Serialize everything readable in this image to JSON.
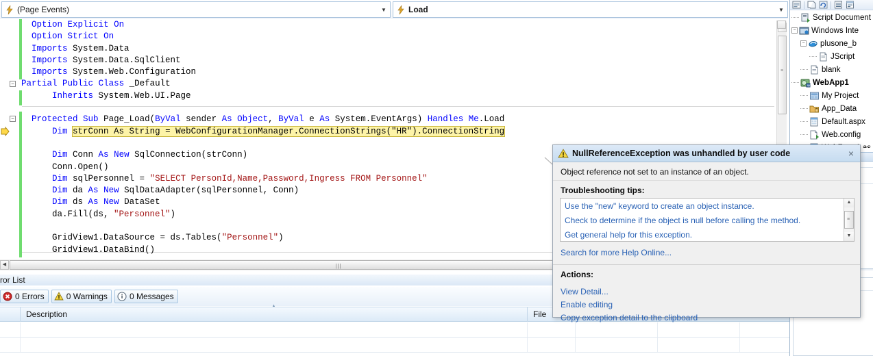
{
  "editor": {
    "member_combo": {
      "icon": "lightning-icon",
      "value": "(Page Events)"
    },
    "event_combo": {
      "icon": "lightning-icon",
      "value": "Load"
    },
    "code_lines": [
      [
        {
          "t": "    ",
          "c": "t"
        },
        {
          "t": "Option",
          "c": "k"
        },
        {
          "t": " ",
          "c": "t"
        },
        {
          "t": "Explicit",
          "c": "k"
        },
        {
          "t": " ",
          "c": "t"
        },
        {
          "t": "On",
          "c": "k"
        }
      ],
      [
        {
          "t": "    ",
          "c": "t"
        },
        {
          "t": "Option",
          "c": "k"
        },
        {
          "t": " ",
          "c": "t"
        },
        {
          "t": "Strict",
          "c": "k"
        },
        {
          "t": " ",
          "c": "t"
        },
        {
          "t": "On",
          "c": "k"
        }
      ],
      [
        {
          "t": "    ",
          "c": "t"
        },
        {
          "t": "Imports",
          "c": "k"
        },
        {
          "t": " System.Data",
          "c": "t"
        }
      ],
      [
        {
          "t": "    ",
          "c": "t"
        },
        {
          "t": "Imports",
          "c": "k"
        },
        {
          "t": " System.Data.SqlClient",
          "c": "t"
        }
      ],
      [
        {
          "t": "    ",
          "c": "t"
        },
        {
          "t": "Imports",
          "c": "k"
        },
        {
          "t": " System.Web.Configuration",
          "c": "t"
        }
      ],
      [
        {
          "t": "  ",
          "c": "t"
        },
        {
          "t": "Partial",
          "c": "k"
        },
        {
          "t": " ",
          "c": "t"
        },
        {
          "t": "Public",
          "c": "k"
        },
        {
          "t": " ",
          "c": "t"
        },
        {
          "t": "Class",
          "c": "k"
        },
        {
          "t": " _Default",
          "c": "t"
        }
      ],
      [
        {
          "t": "        ",
          "c": "t"
        },
        {
          "t": "Inherits",
          "c": "k"
        },
        {
          "t": " System.Web.UI.Page",
          "c": "t"
        }
      ],
      [
        {
          "t": "",
          "c": "t"
        }
      ],
      [
        {
          "t": "    ",
          "c": "t"
        },
        {
          "t": "Protected",
          "c": "k"
        },
        {
          "t": " ",
          "c": "t"
        },
        {
          "t": "Sub",
          "c": "k"
        },
        {
          "t": " Page_Load(",
          "c": "t"
        },
        {
          "t": "ByVal",
          "c": "k"
        },
        {
          "t": " sender ",
          "c": "t"
        },
        {
          "t": "As",
          "c": "k"
        },
        {
          "t": " ",
          "c": "t"
        },
        {
          "t": "Object",
          "c": "k"
        },
        {
          "t": ", ",
          "c": "t"
        },
        {
          "t": "ByVal",
          "c": "k"
        },
        {
          "t": " e ",
          "c": "t"
        },
        {
          "t": "As",
          "c": "k"
        },
        {
          "t": " System.EventArgs) ",
          "c": "t"
        },
        {
          "t": "Handles",
          "c": "k"
        },
        {
          "t": " ",
          "c": "t"
        },
        {
          "t": "Me",
          "c": "k"
        },
        {
          "t": ".Load",
          "c": "t"
        }
      ],
      [
        {
          "t": "        ",
          "c": "t"
        },
        {
          "t": "Dim",
          "c": "k"
        },
        {
          "t": " ",
          "c": "t"
        },
        {
          "t": "strConn As String = WebConfigurationManager.ConnectionStrings(\"HR\").ConnectionString",
          "c": "hl"
        }
      ],
      [
        {
          "t": "",
          "c": "t"
        }
      ],
      [
        {
          "t": "        ",
          "c": "t"
        },
        {
          "t": "Dim",
          "c": "k"
        },
        {
          "t": " Conn ",
          "c": "t"
        },
        {
          "t": "As",
          "c": "k"
        },
        {
          "t": " ",
          "c": "t"
        },
        {
          "t": "New",
          "c": "k"
        },
        {
          "t": " SqlConnection(strConn)",
          "c": "t"
        }
      ],
      [
        {
          "t": "        Conn.Open()",
          "c": "t"
        }
      ],
      [
        {
          "t": "        ",
          "c": "t"
        },
        {
          "t": "Dim",
          "c": "k"
        },
        {
          "t": " sqlPersonnel = ",
          "c": "t"
        },
        {
          "t": "\"SELECT PersonId,Name,Password,Ingress FROM Personnel\"",
          "c": "s"
        }
      ],
      [
        {
          "t": "        ",
          "c": "t"
        },
        {
          "t": "Dim",
          "c": "k"
        },
        {
          "t": " da ",
          "c": "t"
        },
        {
          "t": "As",
          "c": "k"
        },
        {
          "t": " ",
          "c": "t"
        },
        {
          "t": "New",
          "c": "k"
        },
        {
          "t": " SqlDataAdapter(sqlPersonnel, Conn)",
          "c": "t"
        }
      ],
      [
        {
          "t": "        ",
          "c": "t"
        },
        {
          "t": "Dim",
          "c": "k"
        },
        {
          "t": " ds ",
          "c": "t"
        },
        {
          "t": "As",
          "c": "k"
        },
        {
          "t": " ",
          "c": "t"
        },
        {
          "t": "New",
          "c": "k"
        },
        {
          "t": " DataSet",
          "c": "t"
        }
      ],
      [
        {
          "t": "        da.Fill(ds, ",
          "c": "t"
        },
        {
          "t": "\"Personnel\"",
          "c": "s"
        },
        {
          "t": ")",
          "c": "t"
        }
      ],
      [
        {
          "t": "",
          "c": "t"
        }
      ],
      [
        {
          "t": "        GridView1.DataSource = ds.Tables(",
          "c": "t"
        },
        {
          "t": "\"Personnel\"",
          "c": "s"
        },
        {
          "t": ")",
          "c": "t"
        }
      ],
      [
        {
          "t": "        GridView1.DataBind()",
          "c": "t"
        }
      ]
    ]
  },
  "solution_explorer": {
    "toolbar_icons": [
      "properties-icon",
      "copy-icon",
      "refresh-icon",
      "show-all-files-icon",
      "view-designer-icon"
    ],
    "tree": [
      {
        "label": "Script Document",
        "icon": "script-document-icon",
        "depth": 0,
        "expander": "",
        "bold": false
      },
      {
        "label": "Windows Inte",
        "icon": "ie-window-icon",
        "depth": 0,
        "expander": "-",
        "bold": false
      },
      {
        "label": "plusone_b",
        "icon": "internet-explorer-icon",
        "depth": 1,
        "expander": "-",
        "bold": false
      },
      {
        "label": "JScript",
        "icon": "jscript-file-icon",
        "depth": 2,
        "expander": "",
        "bold": false
      },
      {
        "label": "blank",
        "icon": "document-icon",
        "depth": 1,
        "expander": "",
        "bold": false
      },
      {
        "label": "WebApp1",
        "icon": "web-project-icon",
        "depth": 0,
        "expander": "",
        "bold": true
      },
      {
        "label": "My Project",
        "icon": "my-project-icon",
        "depth": 1,
        "expander": "",
        "bold": false
      },
      {
        "label": "App_Data",
        "icon": "app-data-folder-icon",
        "depth": 1,
        "expander": "",
        "bold": false
      },
      {
        "label": "Default.aspx",
        "icon": "aspx-page-icon",
        "depth": 1,
        "expander": "",
        "bold": false
      },
      {
        "label": "Web.config",
        "icon": "config-file-icon",
        "depth": 1,
        "expander": "",
        "bold": false
      },
      {
        "label": "WebForm1.as",
        "icon": "aspx-page-icon",
        "depth": 1,
        "expander": "",
        "bold": false
      }
    ]
  },
  "error_list": {
    "title": "rror List",
    "buttons": [
      {
        "label": "0 Errors",
        "icon": "error-icon"
      },
      {
        "label": "0 Warnings",
        "icon": "warning-icon"
      },
      {
        "label": "0 Messages",
        "icon": "info-icon"
      }
    ],
    "columns": [
      "",
      "Description",
      "File",
      ""
    ]
  },
  "exception_dialog": {
    "icon": "warning-icon",
    "title": "NullReferenceException was unhandled by user code",
    "message": "Object reference not set to an instance of an object.",
    "tips_label": "Troubleshooting tips:",
    "tips": [
      "Use the \"new\" keyword to create an object instance.",
      "Check to determine if the object is null before calling the method.",
      "Get general help for this exception."
    ],
    "search_link": "Search for more Help Online...",
    "actions_label": "Actions:",
    "actions": [
      "View Detail...",
      "Enable editing",
      "Copy exception detail to the clipboard"
    ],
    "close_glyph": "×"
  },
  "colors": {
    "keyword": "#0000ff",
    "string": "#a31515",
    "highlight": "#fdf4a8",
    "link": "#2a62b5",
    "chrome": "#c6dcf0"
  }
}
